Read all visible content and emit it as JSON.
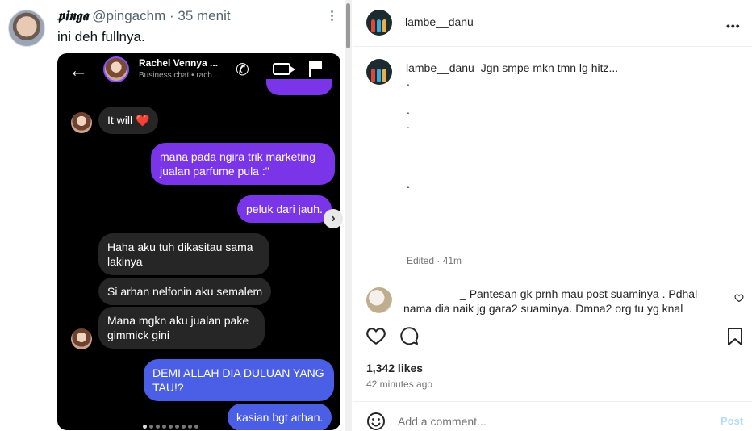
{
  "tweet": {
    "display_name": "𝖕𝖎𝖓𝖌𝖆",
    "handle": "@pingachm",
    "separator": "·",
    "time": "35 menit",
    "text": "ini deh fullnya."
  },
  "chat": {
    "contact_name": "Rachel Vennya ...",
    "contact_sub": "Business chat • rach...",
    "messages": [
      {
        "from": "them",
        "text": "It will"
      },
      {
        "from": "me",
        "text": "mana pada ngira trik marketing jualan parfume pula :\""
      },
      {
        "from": "me",
        "text": "peluk dari jauh."
      },
      {
        "from": "them",
        "text": "Haha aku tuh dikasitau sama lakinya"
      },
      {
        "from": "them",
        "text": "Si arhan nelfonin aku semalem"
      },
      {
        "from": "them",
        "text": "Mana mgkn aku jualan pake gimmick gini"
      },
      {
        "from": "me",
        "text": "DEMI ALLAH DIA DULUAN YANG TAU!?"
      },
      {
        "from": "me",
        "text": "kasian bgt arhan."
      }
    ],
    "heart_emoji": "❤️",
    "carousel_total": 9,
    "carousel_active": 1
  },
  "instagram": {
    "username": "lambe__danu",
    "menu": "•••",
    "caption": "Jgn smpe mkn tmn lg hitz...",
    "caption_dots": [
      ".",
      ".",
      ".",
      "."
    ],
    "edited": "Edited · 41m",
    "comment": {
      "username": "_",
      "text": "Pantesan gk prnh mau post suaminya . Pdhal nama dia naik jg gara2 suaminya. Dmna2 org tu yg knal"
    },
    "likes": "1,342 likes",
    "time": "42 minutes ago",
    "comment_placeholder": "Add a comment...",
    "post_label": "Post"
  },
  "icons": {
    "like": "heart-icon",
    "comment": "comment-icon",
    "save": "bookmark-icon",
    "emoji": "emoji-icon",
    "next": "›"
  },
  "colors": {
    "outgoing_bubble": "#7a35e8",
    "outgoing_bubble_alt": "#4a5ee6",
    "incoming_bubble": "#262626",
    "post_button": "#b3dbff"
  }
}
